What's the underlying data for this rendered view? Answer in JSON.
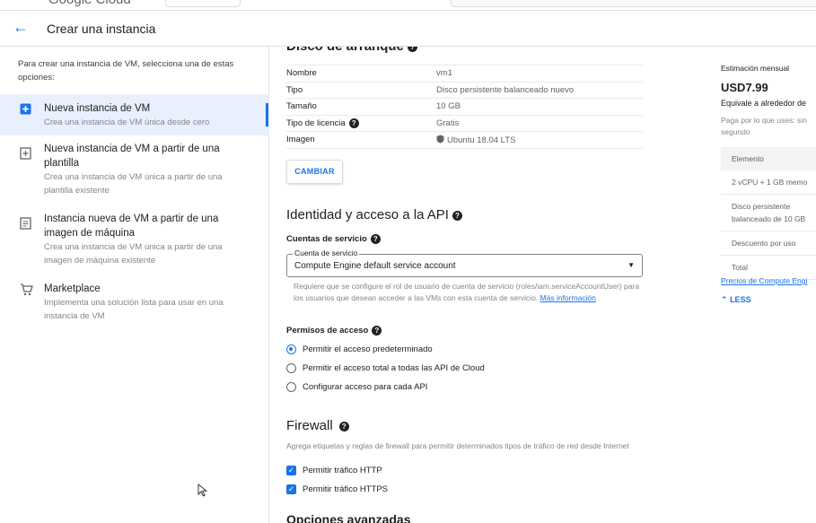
{
  "header": {
    "brand": "Google Cloud",
    "back_icon": "arrow-left-icon",
    "title": "Crear una instancia"
  },
  "left": {
    "intro": "Para crear una instancia de VM, selecciona una de estas opciones:",
    "options": [
      {
        "icon": "add-box-icon",
        "title": "Nueva instancia de VM",
        "desc": "Crea una instancia de VM única desde cero",
        "active": true
      },
      {
        "icon": "template-icon",
        "title": "Nueva instancia de VM a partir de una plantilla",
        "desc": "Crea una instancia de VM única a partir de una plantilla existente",
        "active": false
      },
      {
        "icon": "image-doc-icon",
        "title": "Instancia nueva de VM a partir de una imagen de máquina",
        "desc": "Crea una instancia de VM única a partir de una imagen de máquina existente",
        "active": false
      },
      {
        "icon": "cart-icon",
        "title": "Marketplace",
        "desc": "Implementa una solución lista para usar en una instancia de VM",
        "active": false
      }
    ]
  },
  "disk": {
    "heading": "Disco de arranque",
    "rows": [
      {
        "key": "Nombre",
        "value": "vm1"
      },
      {
        "key": "Tipo",
        "value": "Disco persistente balanceado nuevo"
      },
      {
        "key": "Tamaño",
        "value": "10 GB"
      },
      {
        "key": "Tipo de licencia",
        "value": "Gratis"
      },
      {
        "key": "Imagen",
        "value": "Ubuntu 18.04 LTS"
      }
    ],
    "change_button": "CAMBIAR"
  },
  "identity": {
    "title": "Identidad y acceso a la API",
    "service_accounts_label": "Cuentas de servicio",
    "select_label": "Cuenta de servicio",
    "select_value": "Compute Engine default service account",
    "helper": "Requiere que se configure el rol de usuario de cuenta de servicio (roles/iam.serviceAccountUser) para los usuarios que desean acceder a las VMs con esta cuenta de servicio.",
    "helper_link": "Más información",
    "access_label": "Permisos de acceso",
    "access_options": [
      {
        "label": "Permitir el acceso predeterminado",
        "selected": true
      },
      {
        "label": "Permitir el acceso total a todas las API de Cloud",
        "selected": false
      },
      {
        "label": "Configurar acceso para cada API",
        "selected": false
      }
    ]
  },
  "firewall": {
    "title": "Firewall",
    "desc": "Agrega etiquetas y reglas de firewall para permitir determinados tipos de tráfico de red desde Internet",
    "checks": [
      {
        "label": "Permitir tráfico HTTP",
        "checked": true
      },
      {
        "label": "Permitir tráfico HTTPS",
        "checked": true
      }
    ]
  },
  "advanced": {
    "title": "Opciones avanzadas"
  },
  "estimate": {
    "label": "Estimación mensual",
    "price": "USD7.99",
    "equivalent": "Equivale a alrededor de",
    "note": "Paga por lo que uses: sin segundo",
    "table_header": "Elemento",
    "items": [
      "2 vCPU + 1 GB memo",
      "Disco persistente balanceado de 10 GB",
      "Descuento por uso",
      "Total"
    ],
    "pricing_link": "Precios de Compute Engi",
    "less": "LESS"
  },
  "colors": {
    "accent": "#1a73e8",
    "active_bg": "#e8f0fe"
  }
}
